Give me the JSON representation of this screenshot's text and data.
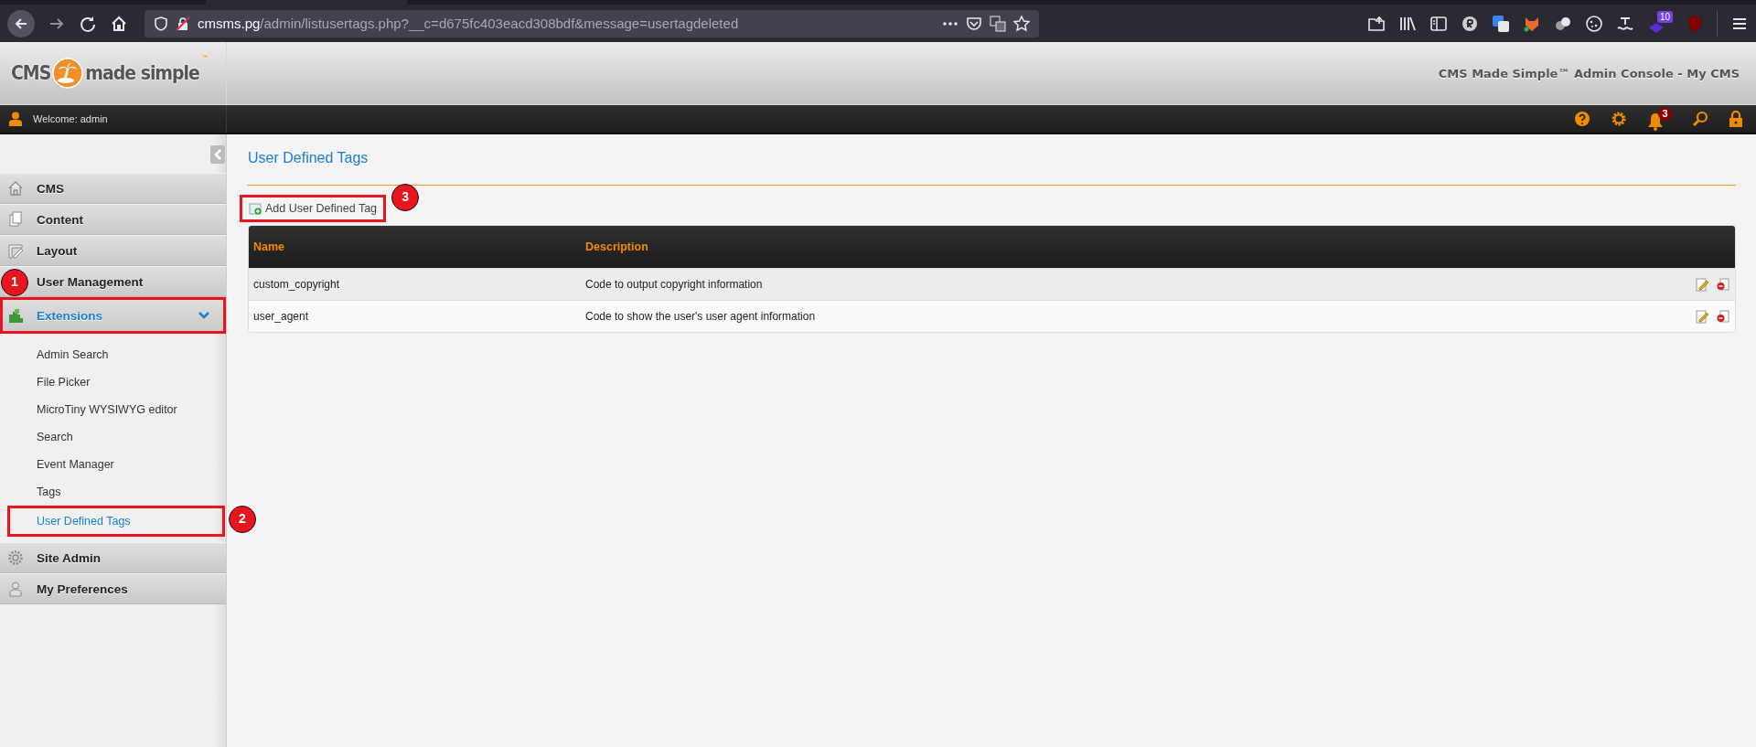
{
  "browser": {
    "url_host": "cmsms.pg",
    "url_path": "/admin/listusertags.php?__c=d675fc403eacd308bdf&message=usertagdeleted",
    "extension_badge": "10"
  },
  "header": {
    "logo_left": "CMS",
    "logo_right": "made simple",
    "logo_mark": "™",
    "title": "CMS Made Simple™ Admin Console - My CMS"
  },
  "user_bar": {
    "welcome": "Welcome: admin",
    "notification_count": "3"
  },
  "sidebar": {
    "sections": [
      {
        "label": "CMS",
        "selected": false,
        "expanded": false,
        "highlighted": false
      },
      {
        "label": "Content",
        "selected": false,
        "expanded": false,
        "highlighted": false
      },
      {
        "label": "Layout",
        "selected": false,
        "expanded": false,
        "highlighted": false
      },
      {
        "label": "User Management",
        "selected": false,
        "expanded": false,
        "highlighted": false
      },
      {
        "label": "Extensions",
        "selected": true,
        "expanded": true,
        "highlighted": true,
        "marker": "1",
        "children": [
          {
            "label": "Admin Search",
            "selected": false,
            "highlighted": false
          },
          {
            "label": "File Picker",
            "selected": false,
            "highlighted": false
          },
          {
            "label": "MicroTiny WYSIWYG editor",
            "selected": false,
            "highlighted": false
          },
          {
            "label": "Search",
            "selected": false,
            "highlighted": false
          },
          {
            "label": "Event Manager",
            "selected": false,
            "highlighted": false
          },
          {
            "label": "Tags",
            "selected": false,
            "highlighted": false
          },
          {
            "label": "User Defined Tags",
            "selected": true,
            "highlighted": true,
            "marker": "2"
          }
        ]
      },
      {
        "label": "Site Admin",
        "selected": false,
        "expanded": false,
        "highlighted": false
      },
      {
        "label": "My Preferences",
        "selected": false,
        "expanded": false,
        "highlighted": false
      }
    ]
  },
  "page": {
    "title": "User Defined Tags",
    "add_link": {
      "label": "Add User Defined Tag",
      "highlighted": true,
      "marker": "3"
    },
    "table": {
      "columns": [
        "Name",
        "Description"
      ],
      "rows": [
        {
          "name": "custom_copyright",
          "description": "Code to output copyright information"
        },
        {
          "name": "user_agent",
          "description": "Code to show the user's user agent information"
        }
      ]
    }
  }
}
